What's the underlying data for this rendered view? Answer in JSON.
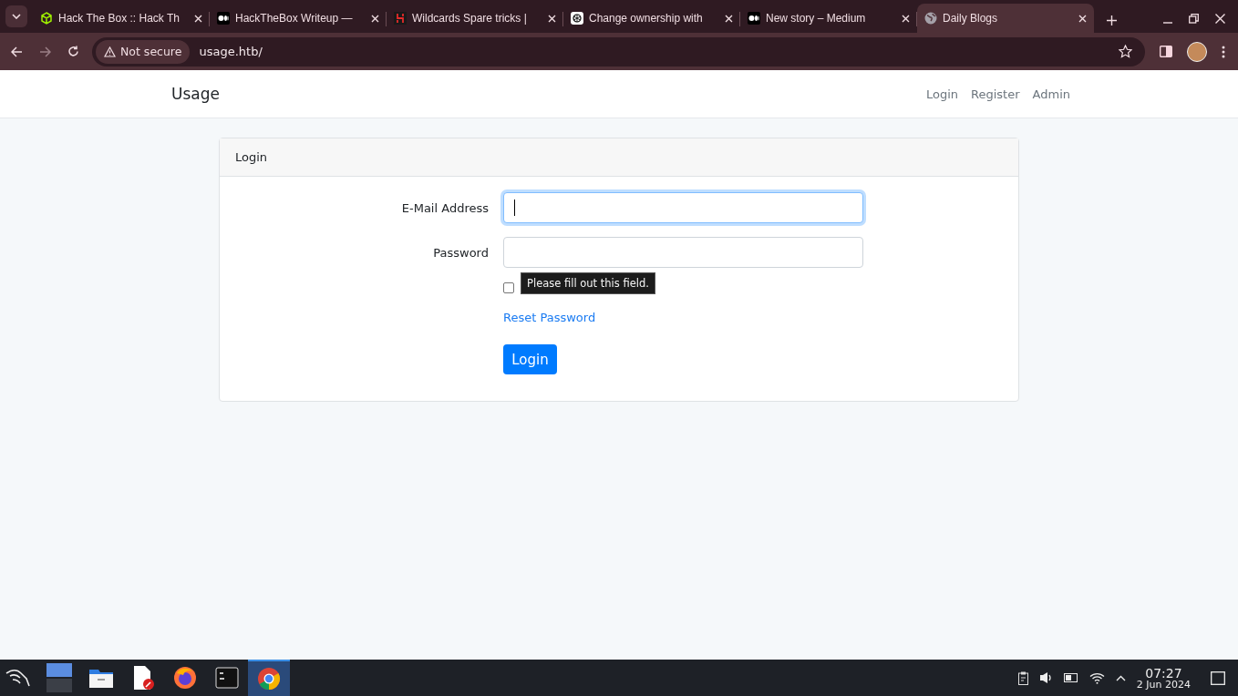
{
  "tabs": [
    {
      "title": "Hack The Box :: Hack Th",
      "kind": "cube",
      "selected": false
    },
    {
      "title": "HackTheBox Writeup —",
      "kind": "medium",
      "selected": false
    },
    {
      "title": "Wildcards Spare tricks |",
      "kind": "h",
      "selected": false
    },
    {
      "title": "Change ownership with",
      "kind": "gpt",
      "selected": false
    },
    {
      "title": "New story – Medium",
      "kind": "medium",
      "selected": false
    },
    {
      "title": "Daily Blogs",
      "kind": "globe",
      "selected": true
    }
  ],
  "address_bar": {
    "security": "Not secure",
    "url": "usage.htb/"
  },
  "navbar": {
    "brand": "Usage",
    "links": [
      "Login",
      "Register",
      "Admin"
    ]
  },
  "card": {
    "header": "Login",
    "fields": [
      {
        "label": "E-Mail Address",
        "focused": true
      },
      {
        "label": "Password",
        "focused": false
      }
    ],
    "remember": {
      "checked": false
    },
    "tooltip": "Please fill out this field.",
    "reset_link": "Reset Password",
    "submit": "Login"
  },
  "taskbar": {
    "apps": [
      {
        "kind": "workspace",
        "active": false
      },
      {
        "kind": "files",
        "active": false
      },
      {
        "kind": "editor",
        "active": false
      },
      {
        "kind": "firefox",
        "active": false
      },
      {
        "kind": "terminal",
        "active": false
      },
      {
        "kind": "chrome",
        "active": true
      }
    ],
    "time": "07:27",
    "date": "2 Jun 2024"
  }
}
